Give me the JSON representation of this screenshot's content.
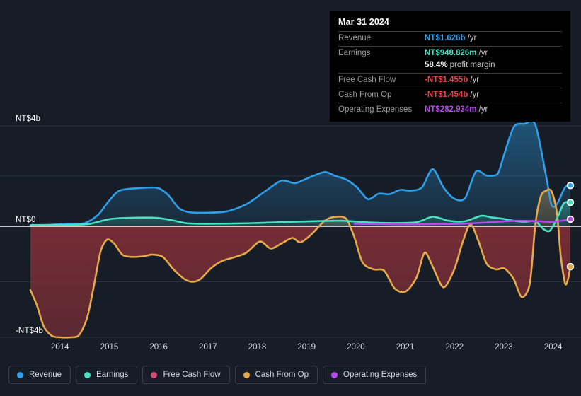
{
  "theme": {
    "background": "#161d27",
    "zero_line": "#ffffff",
    "grid": "#2f3949",
    "negative_fill": "#6d2b32"
  },
  "tooltip": {
    "date": "Mar 31 2024",
    "rows": [
      {
        "label": "Revenue",
        "value": "NT$1.626b",
        "suffix": "/yr",
        "color": "#2e9fe8"
      },
      {
        "label": "Earnings",
        "value": "NT$948.826m",
        "suffix": "/yr",
        "color": "#4ae0c0"
      },
      {
        "label": "",
        "value": "58.4%",
        "suffix": "profit margin",
        "color": "#ffffff"
      },
      {
        "label": "Free Cash Flow",
        "value": "-NT$1.455b",
        "suffix": "/yr",
        "color": "#e8424f"
      },
      {
        "label": "Cash From Op",
        "value": "-NT$1.454b",
        "suffix": "/yr",
        "color": "#e8424f"
      },
      {
        "label": "Operating Expenses",
        "value": "NT$282.934m",
        "suffix": "/yr",
        "color": "#b44ae8"
      }
    ]
  },
  "legend": {
    "items": [
      {
        "label": "Revenue",
        "color": "#2e9fe8"
      },
      {
        "label": "Earnings",
        "color": "#4ae0c0"
      },
      {
        "label": "Free Cash Flow",
        "color": "#d94a78"
      },
      {
        "label": "Cash From Op",
        "color": "#e8a94a"
      },
      {
        "label": "Operating Expenses",
        "color": "#b44ae8"
      }
    ]
  },
  "chart_data": {
    "type": "area",
    "title": "",
    "xlabel": "",
    "ylabel": "",
    "currency": "NT$",
    "ylim": [
      -4.6,
      4.6
    ],
    "yticks": [
      4,
      0,
      -4
    ],
    "ytick_labels": [
      "NT$4b",
      "NT$0",
      "-NT$4b"
    ],
    "grid": true,
    "legend_position": "bottom-left",
    "x": [
      2013.4,
      2014,
      2015,
      2016,
      2017,
      2018,
      2019,
      2020,
      2021,
      2022,
      2023,
      2024,
      2024.35
    ],
    "xticks": [
      2014,
      2015,
      2016,
      2017,
      2018,
      2019,
      2020,
      2021,
      2022,
      2023,
      2024
    ],
    "xtick_labels": [
      "2014",
      "2015",
      "2016",
      "2017",
      "2018",
      "2019",
      "2020",
      "2021",
      "2022",
      "2023",
      "2024"
    ],
    "series": [
      {
        "name": "Revenue",
        "color": "#2e9fe8",
        "fill": true,
        "points": [
          [
            0.0,
            0.05
          ],
          [
            0.035,
            0.06
          ],
          [
            0.07,
            0.1
          ],
          [
            0.1,
            0.12
          ],
          [
            0.125,
            0.45
          ],
          [
            0.145,
            1.0
          ],
          [
            0.165,
            1.42
          ],
          [
            0.2,
            1.52
          ],
          [
            0.235,
            1.53
          ],
          [
            0.255,
            1.25
          ],
          [
            0.275,
            0.72
          ],
          [
            0.295,
            0.56
          ],
          [
            0.33,
            0.54
          ],
          [
            0.365,
            0.6
          ],
          [
            0.4,
            0.88
          ],
          [
            0.435,
            1.4
          ],
          [
            0.465,
            1.82
          ],
          [
            0.49,
            1.72
          ],
          [
            0.515,
            1.93
          ],
          [
            0.545,
            2.16
          ],
          [
            0.565,
            2.0
          ],
          [
            0.585,
            1.86
          ],
          [
            0.605,
            1.55
          ],
          [
            0.625,
            1.08
          ],
          [
            0.645,
            1.3
          ],
          [
            0.665,
            1.28
          ],
          [
            0.685,
            1.45
          ],
          [
            0.705,
            1.42
          ],
          [
            0.725,
            1.55
          ],
          [
            0.745,
            2.28
          ],
          [
            0.765,
            1.55
          ],
          [
            0.785,
            1.1
          ],
          [
            0.805,
            1.12
          ],
          [
            0.825,
            2.18
          ],
          [
            0.845,
            2.02
          ],
          [
            0.865,
            2.08
          ],
          [
            0.875,
            2.7
          ],
          [
            0.895,
            3.95
          ],
          [
            0.915,
            4.08
          ],
          [
            0.935,
            4.05
          ],
          [
            0.955,
            2.0
          ],
          [
            0.965,
            0.86
          ],
          [
            0.975,
            0.88
          ],
          [
            0.99,
            1.55
          ],
          [
            1.0,
            1.63
          ]
        ]
      },
      {
        "name": "Earnings",
        "color": "#4ae0c0",
        "fill": true,
        "points": [
          [
            0.0,
            0.04
          ],
          [
            0.08,
            0.06
          ],
          [
            0.11,
            0.1
          ],
          [
            0.145,
            0.28
          ],
          [
            0.175,
            0.33
          ],
          [
            0.23,
            0.34
          ],
          [
            0.26,
            0.25
          ],
          [
            0.29,
            0.12
          ],
          [
            0.33,
            0.1
          ],
          [
            0.4,
            0.12
          ],
          [
            0.46,
            0.16
          ],
          [
            0.52,
            0.2
          ],
          [
            0.575,
            0.22
          ],
          [
            0.63,
            0.15
          ],
          [
            0.67,
            0.13
          ],
          [
            0.715,
            0.16
          ],
          [
            0.745,
            0.38
          ],
          [
            0.775,
            0.22
          ],
          [
            0.805,
            0.2
          ],
          [
            0.835,
            0.42
          ],
          [
            0.855,
            0.35
          ],
          [
            0.875,
            0.3
          ],
          [
            0.895,
            0.22
          ],
          [
            0.915,
            0.18
          ],
          [
            0.935,
            0.2
          ],
          [
            0.95,
            -0.1
          ],
          [
            0.962,
            -0.16
          ],
          [
            0.975,
            0.3
          ],
          [
            0.988,
            0.92
          ],
          [
            1.0,
            0.95
          ]
        ]
      },
      {
        "name": "Operating Expenses",
        "color": "#b44ae8",
        "fill": false,
        "start_x": 0.6,
        "points": [
          [
            0.6,
            0.1
          ],
          [
            0.65,
            0.09
          ],
          [
            0.7,
            0.08
          ],
          [
            0.75,
            0.09
          ],
          [
            0.8,
            0.1
          ],
          [
            0.85,
            0.16
          ],
          [
            0.9,
            0.22
          ],
          [
            0.94,
            0.2
          ],
          [
            0.97,
            0.18
          ],
          [
            1.0,
            0.28
          ]
        ]
      },
      {
        "name": "Cash From Op",
        "color": "#e8a94a",
        "fill": true,
        "points": [
          [
            0.0,
            -2.3
          ],
          [
            0.012,
            -2.85
          ],
          [
            0.025,
            -3.62
          ],
          [
            0.04,
            -3.95
          ],
          [
            0.055,
            -4.0
          ],
          [
            0.075,
            -4.0
          ],
          [
            0.09,
            -3.92
          ],
          [
            0.105,
            -3.3
          ],
          [
            0.118,
            -2.1
          ],
          [
            0.13,
            -0.9
          ],
          [
            0.142,
            -0.48
          ],
          [
            0.155,
            -0.62
          ],
          [
            0.17,
            -1.02
          ],
          [
            0.185,
            -1.1
          ],
          [
            0.21,
            -1.08
          ],
          [
            0.225,
            -1.02
          ],
          [
            0.245,
            -1.1
          ],
          [
            0.265,
            -1.55
          ],
          [
            0.285,
            -1.9
          ],
          [
            0.3,
            -2.0
          ],
          [
            0.315,
            -1.9
          ],
          [
            0.335,
            -1.5
          ],
          [
            0.355,
            -1.25
          ],
          [
            0.38,
            -1.1
          ],
          [
            0.4,
            -0.95
          ],
          [
            0.425,
            -0.55
          ],
          [
            0.445,
            -0.8
          ],
          [
            0.465,
            -0.62
          ],
          [
            0.485,
            -0.42
          ],
          [
            0.5,
            -0.58
          ],
          [
            0.52,
            -0.3
          ],
          [
            0.545,
            0.22
          ],
          [
            0.565,
            0.38
          ],
          [
            0.585,
            0.3
          ],
          [
            0.6,
            -0.4
          ],
          [
            0.615,
            -1.3
          ],
          [
            0.635,
            -1.55
          ],
          [
            0.655,
            -1.6
          ],
          [
            0.675,
            -2.25
          ],
          [
            0.695,
            -2.35
          ],
          [
            0.715,
            -1.85
          ],
          [
            0.73,
            -0.95
          ],
          [
            0.745,
            -1.45
          ],
          [
            0.765,
            -2.2
          ],
          [
            0.785,
            -1.55
          ],
          [
            0.8,
            -0.6
          ],
          [
            0.815,
            0.08
          ],
          [
            0.83,
            -0.55
          ],
          [
            0.845,
            -1.35
          ],
          [
            0.862,
            -1.55
          ],
          [
            0.878,
            -1.52
          ],
          [
            0.895,
            -1.9
          ],
          [
            0.91,
            -2.55
          ],
          [
            0.925,
            -2.05
          ],
          [
            0.935,
            0.05
          ],
          [
            0.945,
            1.18
          ],
          [
            0.955,
            1.42
          ],
          [
            0.965,
            1.4
          ],
          [
            0.975,
            0.55
          ],
          [
            0.982,
            -1.05
          ],
          [
            0.99,
            -2.05
          ],
          [
            0.995,
            -1.95
          ],
          [
            1.0,
            -1.45
          ]
        ]
      }
    ],
    "end_markers": [
      {
        "series": "Revenue",
        "value": 1.626,
        "color": "#2e9fe8"
      },
      {
        "series": "Earnings",
        "value": 0.949,
        "color": "#4ae0c0"
      },
      {
        "series": "Operating Expenses",
        "value": 0.283,
        "color": "#b44ae8"
      },
      {
        "series": "Cash From Op",
        "value": -1.454,
        "color": "#e8a94a"
      }
    ]
  }
}
